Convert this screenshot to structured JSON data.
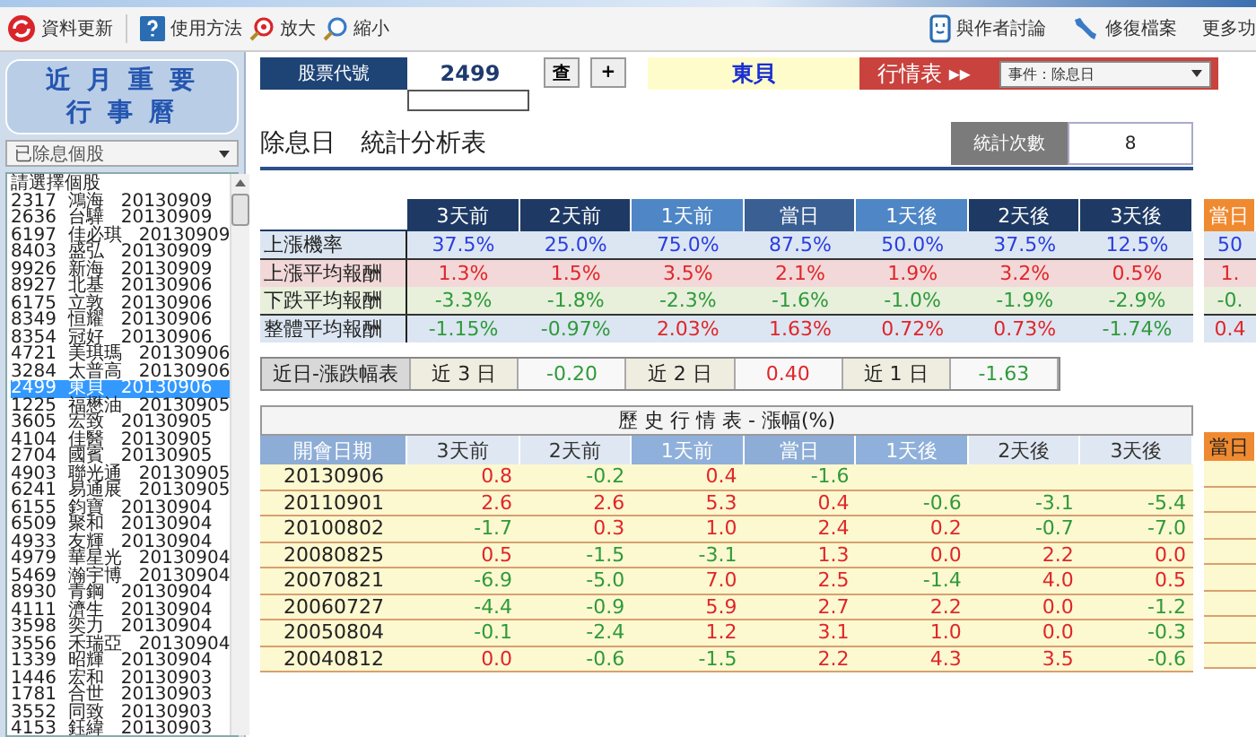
{
  "toolbar": {
    "left": [
      {
        "label": "資料更新"
      },
      {
        "label": "使用方法"
      },
      {
        "label": "放大"
      },
      {
        "label": "縮小"
      }
    ],
    "right": [
      {
        "label": "與作者討論"
      },
      {
        "label": "修復檔案"
      },
      {
        "label": "更多功"
      }
    ]
  },
  "sidebar": {
    "title_lines": [
      "近 月 重 要",
      "行 事 曆"
    ],
    "dropdown": "已除息個股",
    "list_header": "請選擇個股",
    "items": [
      {
        "code": "2317",
        "name": "鴻海",
        "date": "20130909",
        "selected": false
      },
      {
        "code": "2636",
        "name": "台驊",
        "date": "20130909",
        "selected": false
      },
      {
        "code": "6197",
        "name": "佳必琪",
        "date": "20130909",
        "selected": false
      },
      {
        "code": "8403",
        "name": "盛弘",
        "date": "20130909",
        "selected": false
      },
      {
        "code": "9926",
        "name": "新海",
        "date": "20130909",
        "selected": false
      },
      {
        "code": "8927",
        "name": "北基",
        "date": "20130906",
        "selected": false
      },
      {
        "code": "6175",
        "name": "立敦",
        "date": "20130906",
        "selected": false
      },
      {
        "code": "8349",
        "name": "恒耀",
        "date": "20130906",
        "selected": false
      },
      {
        "code": "8354",
        "name": "冠好",
        "date": "20130906",
        "selected": false
      },
      {
        "code": "4721",
        "name": "美琪瑪",
        "date": "20130906",
        "selected": false
      },
      {
        "code": "3284",
        "name": "太普高",
        "date": "20130906",
        "selected": false
      },
      {
        "code": "2499",
        "name": "東貝",
        "date": "20130906",
        "selected": true
      },
      {
        "code": "1225",
        "name": "福懋油",
        "date": "20130905",
        "selected": false
      },
      {
        "code": "3605",
        "name": "宏致",
        "date": "20130905",
        "selected": false
      },
      {
        "code": "4104",
        "name": "佳醫",
        "date": "20130905",
        "selected": false
      },
      {
        "code": "2704",
        "name": "國賓",
        "date": "20130905",
        "selected": false
      },
      {
        "code": "4903",
        "name": "聯光通",
        "date": "20130905",
        "selected": false
      },
      {
        "code": "6241",
        "name": "易通展",
        "date": "20130905",
        "selected": false
      },
      {
        "code": "6155",
        "name": "鈞寶",
        "date": "20130904",
        "selected": false
      },
      {
        "code": "6509",
        "name": "聚和",
        "date": "20130904",
        "selected": false
      },
      {
        "code": "4933",
        "name": "友輝",
        "date": "20130904",
        "selected": false
      },
      {
        "code": "4979",
        "name": "華星光",
        "date": "20130904",
        "selected": false
      },
      {
        "code": "5469",
        "name": "瀚宇博",
        "date": "20130904",
        "selected": false
      },
      {
        "code": "8930",
        "name": "青鋼",
        "date": "20130904",
        "selected": false
      },
      {
        "code": "4111",
        "name": "濟生",
        "date": "20130904",
        "selected": false
      },
      {
        "code": "3598",
        "name": "奕力",
        "date": "20130904",
        "selected": false
      },
      {
        "code": "3556",
        "name": "禾瑞亞",
        "date": "20130904",
        "selected": false
      },
      {
        "code": "1339",
        "name": "昭輝",
        "date": "20130904",
        "selected": false
      },
      {
        "code": "1446",
        "name": "宏和",
        "date": "20130903",
        "selected": false
      },
      {
        "code": "1781",
        "name": "合世",
        "date": "20130903",
        "selected": false
      },
      {
        "code": "3552",
        "name": "同致",
        "date": "20130903",
        "selected": false
      },
      {
        "code": "4153",
        "name": "鈺緯",
        "date": "20130903",
        "selected": false
      }
    ]
  },
  "search": {
    "label": "股票代號",
    "value": "2499",
    "buttons": [
      "查",
      "+"
    ],
    "stock_name": "東貝",
    "quote_label": "行情表 ▸▸",
    "event_dropdown": "事件：除息日"
  },
  "heading": "除息日　統計分析表",
  "count_label": "統計次數",
  "count": "8",
  "columns": [
    {
      "label": "3天前",
      "kind": "dark"
    },
    {
      "label": "2天前",
      "kind": "dark"
    },
    {
      "label": "1天前",
      "kind": "light"
    },
    {
      "label": "當日",
      "kind": "mid"
    },
    {
      "label": "1天後",
      "kind": "light"
    },
    {
      "label": "2天後",
      "kind": "dark"
    },
    {
      "label": "3天後",
      "kind": "dark"
    }
  ],
  "stats": [
    {
      "label": "上漲機率",
      "kind": "prob",
      "values": [
        {
          "text": "37.5%"
        },
        {
          "text": "25.0%"
        },
        {
          "text": "75.0%"
        },
        {
          "text": "87.5%"
        },
        {
          "text": "50.0%"
        },
        {
          "text": "37.5%"
        },
        {
          "text": "12.5%"
        }
      ]
    },
    {
      "label": "上漲平均報酬",
      "kind": "gain",
      "values": [
        {
          "text": "1.3%",
          "up": true
        },
        {
          "text": "1.5%",
          "up": true
        },
        {
          "text": "3.5%",
          "up": true
        },
        {
          "text": "2.1%",
          "up": true
        },
        {
          "text": "1.9%",
          "up": true
        },
        {
          "text": "3.2%",
          "up": true
        },
        {
          "text": "0.5%",
          "up": true
        }
      ]
    },
    {
      "label": "下跌平均報酬",
      "kind": "loss",
      "values": [
        {
          "text": "-3.3%",
          "up": false
        },
        {
          "text": "-1.8%",
          "up": false
        },
        {
          "text": "-2.3%",
          "up": false
        },
        {
          "text": "-1.6%",
          "up": false
        },
        {
          "text": "-1.0%",
          "up": false
        },
        {
          "text": "-1.9%",
          "up": false
        },
        {
          "text": "-2.9%",
          "up": false
        }
      ]
    },
    {
      "label": "整體平均報酬",
      "kind": "prob",
      "values": [
        {
          "text": "-1.15%",
          "up": false
        },
        {
          "text": "-0.97%",
          "up": false
        },
        {
          "text": "2.03%",
          "up": true
        },
        {
          "text": "1.63%",
          "up": true
        },
        {
          "text": "0.72%",
          "up": true
        },
        {
          "text": "0.73%",
          "up": true
        },
        {
          "text": "-1.74%",
          "up": false
        }
      ]
    }
  ],
  "side_column": {
    "label": "當日",
    "values": [
      {
        "text": "50"
      },
      {
        "text": "1.",
        "up": true
      },
      {
        "text": "-0.",
        "up": false
      },
      {
        "text": "0.4",
        "up": true
      }
    ]
  },
  "recent": {
    "label": "近日-漲跌幅表",
    "items": [
      {
        "label": "近 3 日",
        "value": "-0.20",
        "up": false
      },
      {
        "label": "近 2 日",
        "value": "0.40",
        "up": true
      },
      {
        "label": "近 1 日",
        "value": "-1.63",
        "up": false
      }
    ]
  },
  "history": {
    "title": "歷 史 行 情 表 - 漲幅(%)",
    "date_header": "開會日期",
    "side_header": "當日",
    "columns": [
      {
        "label": "3天前",
        "kind": "dark"
      },
      {
        "label": "2天前",
        "kind": "dark"
      },
      {
        "label": "1天前",
        "kind": "light"
      },
      {
        "label": "當日",
        "kind": "mid"
      },
      {
        "label": "1天後",
        "kind": "light"
      },
      {
        "label": "2天後",
        "kind": "dark"
      },
      {
        "label": "3天後",
        "kind": "dark"
      }
    ],
    "rows": [
      {
        "date": "20130906",
        "cells": [
          {
            "text": "0.8",
            "up": true
          },
          {
            "text": "-0.2",
            "up": false
          },
          {
            "text": "0.4",
            "up": true
          },
          {
            "text": "-1.6",
            "up": false
          }
        ]
      },
      {
        "date": "20110901",
        "cells": [
          {
            "text": "2.6",
            "up": true
          },
          {
            "text": "2.6",
            "up": true
          },
          {
            "text": "5.3",
            "up": true
          },
          {
            "text": "0.4",
            "up": true
          },
          {
            "text": "-0.6",
            "up": false
          },
          {
            "text": "-3.1",
            "up": false
          },
          {
            "text": "-5.4",
            "up": false
          }
        ]
      },
      {
        "date": "20100802",
        "cells": [
          {
            "text": "-1.7",
            "up": false
          },
          {
            "text": "0.3",
            "up": true
          },
          {
            "text": "1.0",
            "up": true
          },
          {
            "text": "2.4",
            "up": true
          },
          {
            "text": "0.2",
            "up": true
          },
          {
            "text": "-0.7",
            "up": false
          },
          {
            "text": "-7.0",
            "up": false
          }
        ]
      },
      {
        "date": "20080825",
        "cells": [
          {
            "text": "0.5",
            "up": true
          },
          {
            "text": "-1.5",
            "up": false
          },
          {
            "text": "-3.1",
            "up": false
          },
          {
            "text": "1.3",
            "up": true
          },
          {
            "text": "0.0",
            "up": true
          },
          {
            "text": "2.2",
            "up": true
          },
          {
            "text": "0.0",
            "up": true
          }
        ]
      },
      {
        "date": "20070821",
        "cells": [
          {
            "text": "-6.9",
            "up": false
          },
          {
            "text": "-5.0",
            "up": false
          },
          {
            "text": "7.0",
            "up": true
          },
          {
            "text": "2.5",
            "up": true
          },
          {
            "text": "-1.4",
            "up": false
          },
          {
            "text": "4.0",
            "up": true
          },
          {
            "text": "0.5",
            "up": true
          }
        ]
      },
      {
        "date": "20060727",
        "cells": [
          {
            "text": "-4.4",
            "up": false
          },
          {
            "text": "-0.9",
            "up": false
          },
          {
            "text": "5.9",
            "up": true
          },
          {
            "text": "2.7",
            "up": true
          },
          {
            "text": "2.2",
            "up": true
          },
          {
            "text": "0.0",
            "up": true
          },
          {
            "text": "-1.2",
            "up": false
          }
        ]
      },
      {
        "date": "20050804",
        "cells": [
          {
            "text": "-0.1",
            "up": false
          },
          {
            "text": "-2.4",
            "up": false
          },
          {
            "text": "1.2",
            "up": true
          },
          {
            "text": "3.1",
            "up": true
          },
          {
            "text": "1.0",
            "up": true
          },
          {
            "text": "0.0",
            "up": true
          },
          {
            "text": "-0.3",
            "up": false
          }
        ]
      },
      {
        "date": "20040812",
        "cells": [
          {
            "text": "0.0",
            "up": true
          },
          {
            "text": "-0.6",
            "up": false
          },
          {
            "text": "-1.5",
            "up": false
          },
          {
            "text": "2.2",
            "up": true
          },
          {
            "text": "4.3",
            "up": true
          },
          {
            "text": "3.5",
            "up": true
          },
          {
            "text": "-0.6",
            "up": false
          }
        ]
      }
    ]
  }
}
